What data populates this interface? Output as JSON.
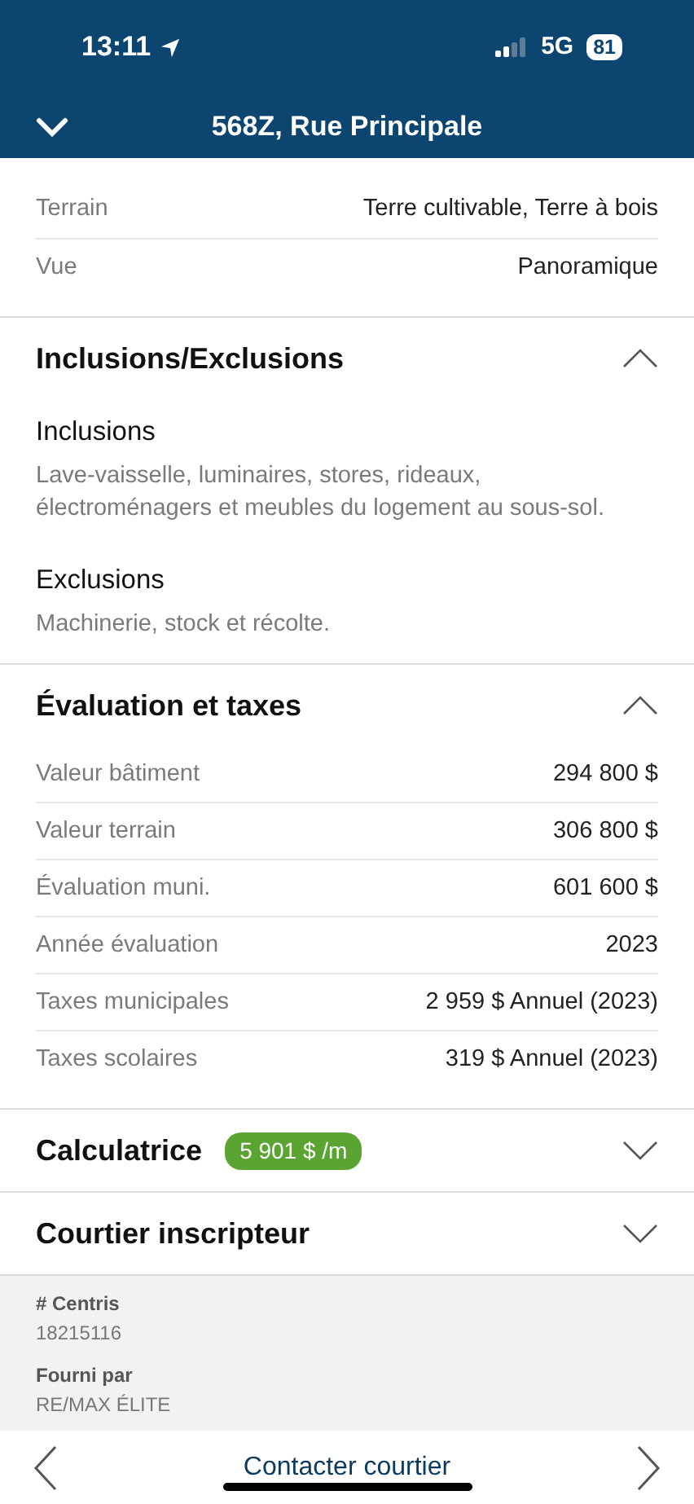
{
  "status_bar": {
    "time": "13:11",
    "network": "5G",
    "battery": "81"
  },
  "header": {
    "title": "568Z, Rue Principale"
  },
  "top_rows": [
    {
      "label": "Terrain",
      "value": "Terre cultivable, Terre à bois"
    },
    {
      "label": "Vue",
      "value": "Panoramique"
    }
  ],
  "sections": [
    {
      "kind": "blocks",
      "title": "Inclusions/Exclusions",
      "expanded": true,
      "blocks": [
        {
          "heading": "Inclusions",
          "text": "Lave-vaisselle, luminaires, stores, rideaux, électroménagers et meubles du logement au sous-sol."
        },
        {
          "heading": "Exclusions",
          "text": "Machinerie, stock et récolte."
        }
      ]
    },
    {
      "kind": "rows",
      "title": "Évaluation et taxes",
      "expanded": true,
      "rows": [
        {
          "label": "Valeur bâtiment",
          "value": "294 800 $"
        },
        {
          "label": "Valeur terrain",
          "value": "306 800 $"
        },
        {
          "label": "Évaluation muni.",
          "value": "601 600 $"
        },
        {
          "label": "Année évaluation",
          "value": "2023"
        },
        {
          "label": "Taxes municipales",
          "value": "2 959 $ Annuel (2023)"
        },
        {
          "label": "Taxes scolaires",
          "value": "319 $ Annuel (2023)"
        }
      ]
    },
    {
      "title": "Calculatrice",
      "expanded": false,
      "badge": "5 901 $ /m"
    },
    {
      "title": "Courtier inscripteur",
      "expanded": false
    }
  ],
  "info": [
    {
      "label": "# Centris",
      "value": "18215116"
    },
    {
      "label": "Fourni par",
      "value": "RE/MAX ÉLITE"
    }
  ],
  "bottom_bar": {
    "action": "Contacter courtier"
  }
}
